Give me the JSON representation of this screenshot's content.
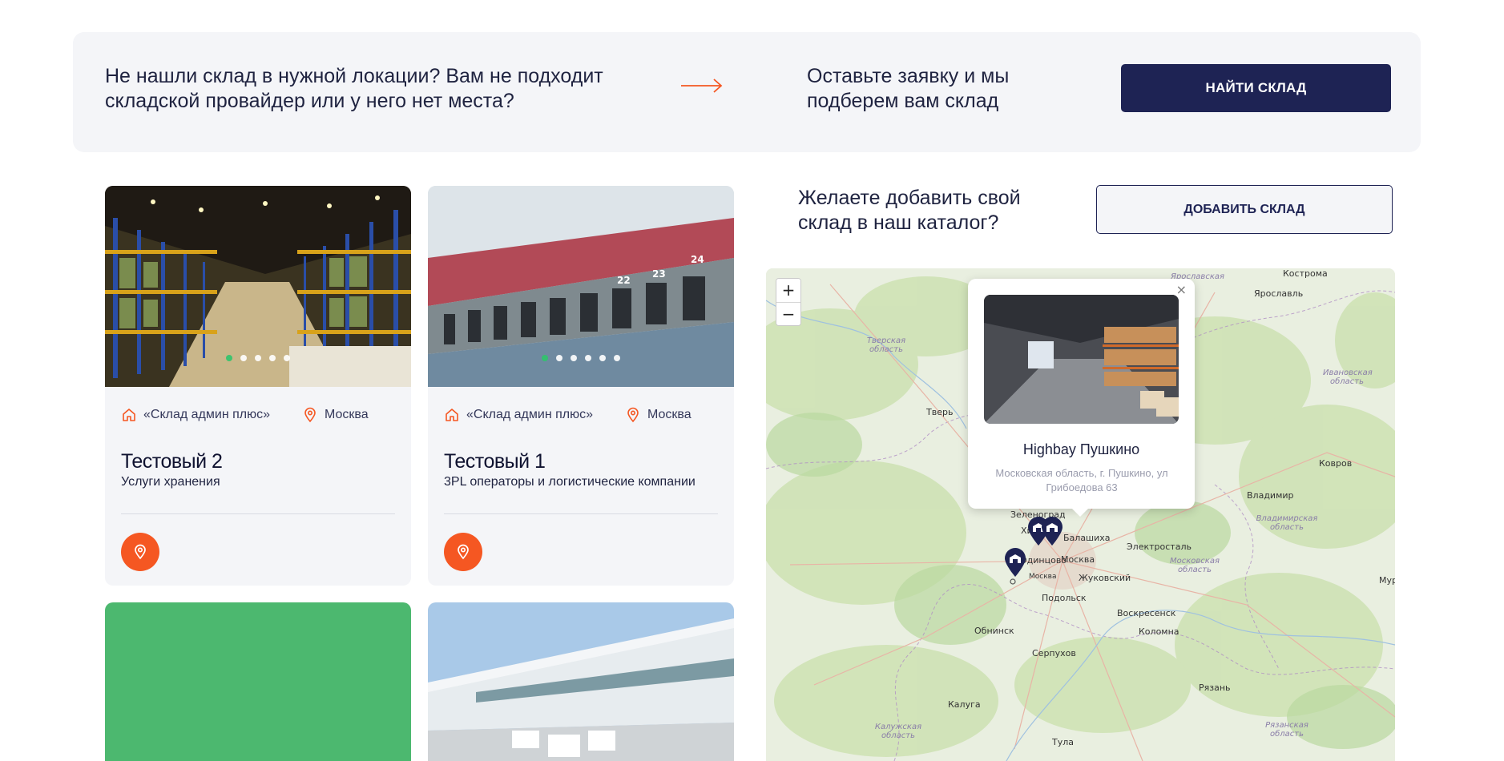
{
  "banner": {
    "text": "Не нашли склад в нужной локации? Вам не подходит складской провайдер или у него нет места?",
    "cta_text": "Оставьте заявку и мы подберем вам склад",
    "find_button": "НАЙТИ СКЛАД"
  },
  "cards": [
    {
      "company": "«Склад админ плюс»",
      "city": "Москва",
      "title": "Тестовый 2",
      "subtitle": "Услуги хранения",
      "slides": 5,
      "active_slide": 0
    },
    {
      "company": "«Склад админ плюс»",
      "city": "Москва",
      "title": "Тестовый 1",
      "subtitle": "3PL операторы и логистические компании",
      "slides": 6,
      "active_slide": 0
    }
  ],
  "add": {
    "text": "Желаете добавить свой склад в наш каталог?",
    "button": "ДОБАВИТЬ СКЛАД"
  },
  "map": {
    "zoom_in": "+",
    "zoom_out": "−",
    "popup": {
      "close": "×",
      "title": "Highbay Пушкино",
      "address": "Московская область, г. Пушкино, ул Грибоедова 63"
    },
    "labels": {
      "kostroma": "Кострома",
      "yaroslavl": "Ярославль",
      "yaroslavl_obl": "Ярославская",
      "tver": "Тверь",
      "tver_obl": "Тверская область",
      "ivanovo_obl": "Ивановская область",
      "kovrov": "Ковров",
      "vladimir": "Владимир",
      "vladimir_obl": "Владимирская область",
      "zelenograd": "Зеленоград",
      "khimki": "Химки",
      "balashikha": "Балашиха",
      "elektrostal": "Электросталь",
      "odintsovo": "Одинцово",
      "moskva": "Москва",
      "moskva2": "Москва",
      "zhukovsky": "Жуковский",
      "moscow_obl": "Московская область",
      "podolsk": "Подольск",
      "voskresensk": "Воскресенск",
      "obninsk": "Обнинск",
      "kolomna": "Коломна",
      "serpukhov": "Серпухов",
      "kaluga": "Калуга",
      "kaluga_obl": "Калужская область",
      "ryazan": "Рязань",
      "ryazan_obl": "Рязанская область",
      "tula": "Тула",
      "murom": "Муро"
    }
  },
  "colors": {
    "navy": "#1e2354",
    "accent": "#f55722",
    "card_bg": "#f4f5f8",
    "active_dot": "#2fc46a",
    "green_placeholder": "#4cb86f"
  }
}
